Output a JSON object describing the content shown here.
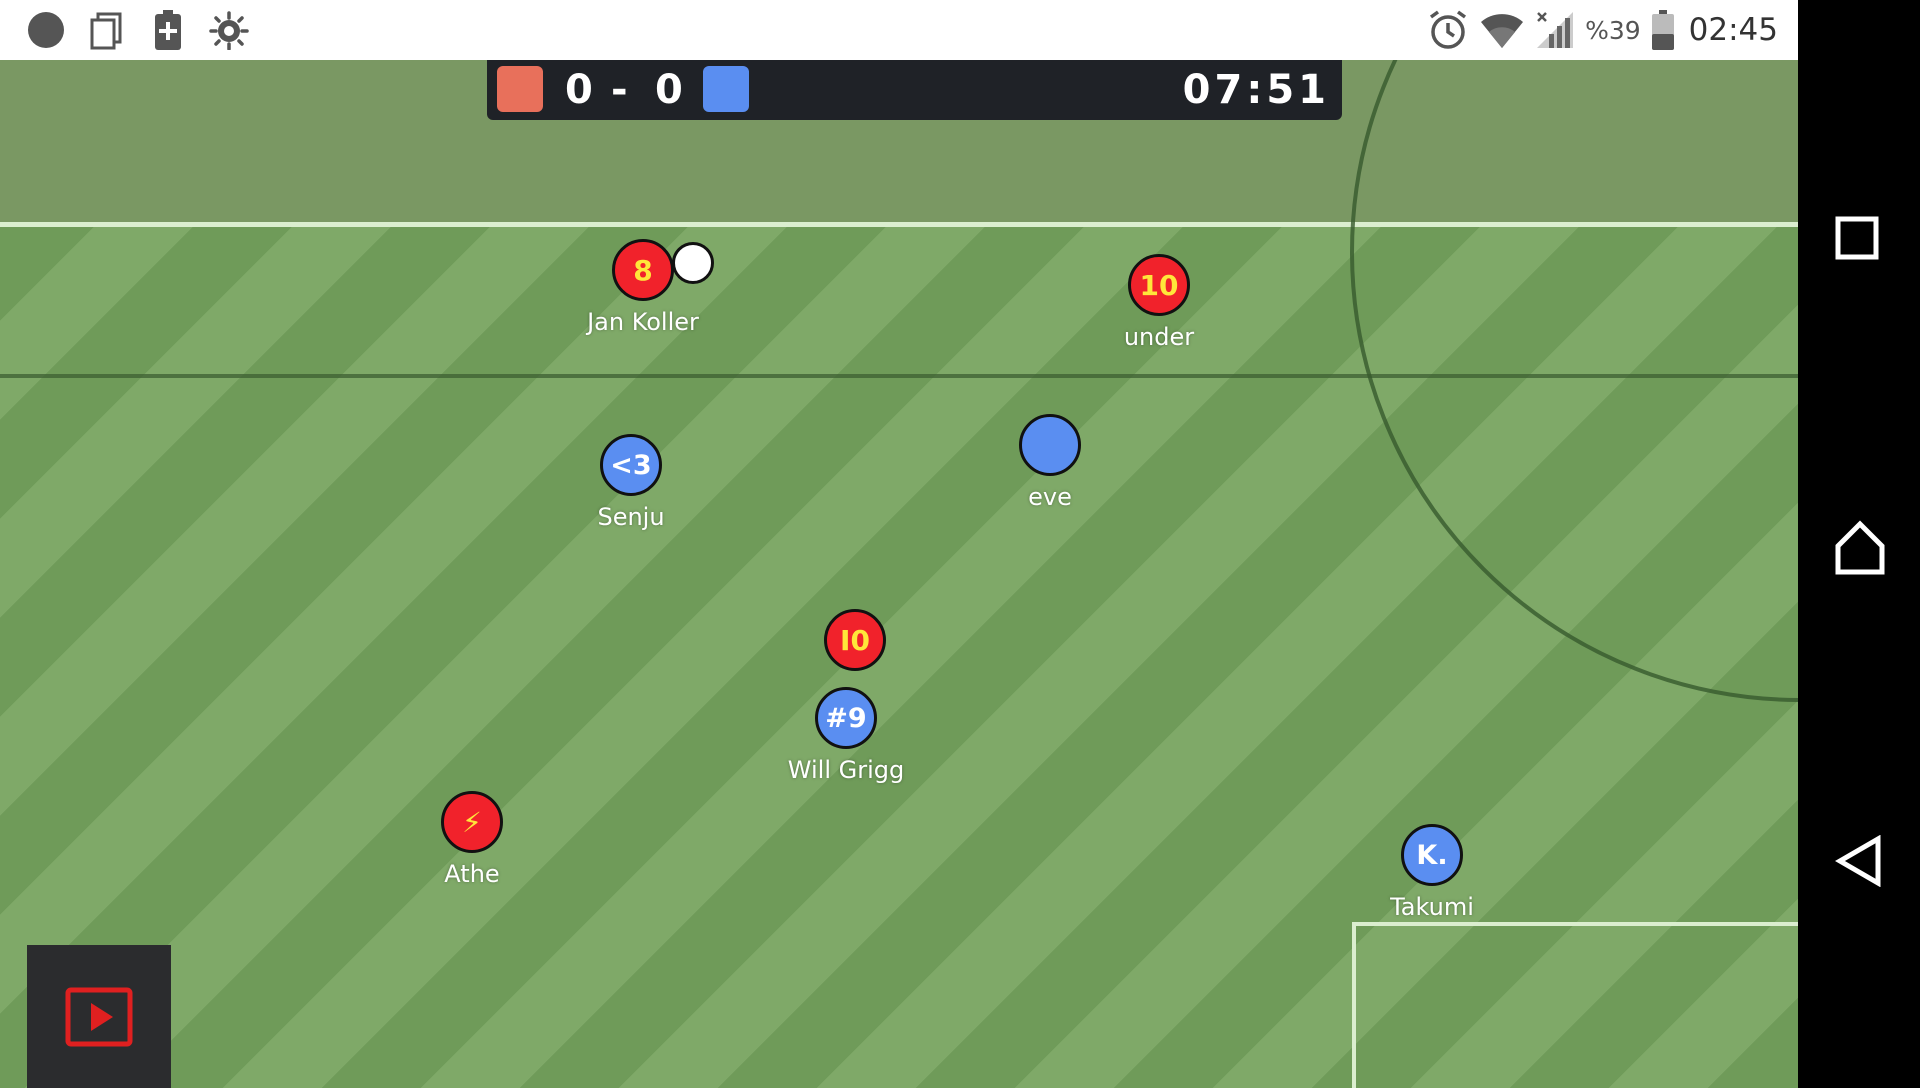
{
  "status_bar": {
    "icons_left": [
      "circle-dot-icon",
      "copy-icon",
      "battery-plus-icon",
      "bug-icon"
    ],
    "icons_right": [
      "alarm-icon",
      "wifi-icon",
      "signal-icon",
      "battery-icon"
    ],
    "battery_percent": "%39",
    "time": "02:45"
  },
  "scoreboard": {
    "home_color": "#e8705b",
    "away_color": "#5a8ef1",
    "home_score": "0",
    "separator": "-",
    "away_score": "0",
    "clock": "07:51"
  },
  "players": [
    {
      "id": "p-jan-koller",
      "team": "red",
      "badge": "8",
      "name": "Jan Koller"
    },
    {
      "id": "p-under",
      "team": "red",
      "badge": "10",
      "name": "under"
    },
    {
      "id": "p-senju",
      "team": "blue",
      "badge": "<3",
      "name": "Senju"
    },
    {
      "id": "p-eve",
      "team": "blue",
      "badge": "",
      "name": "eve"
    },
    {
      "id": "p-red-10b",
      "team": "red",
      "badge": "I0",
      "name": ""
    },
    {
      "id": "p-will-grigg",
      "team": "blue",
      "badge": "#9",
      "name": "Will Grigg"
    },
    {
      "id": "p-athe",
      "team": "red",
      "badge": "⚡",
      "name": "Athe"
    },
    {
      "id": "p-takumi",
      "team": "blue",
      "badge": "K.",
      "name": "Takumi"
    }
  ],
  "replay_button": {
    "icon": "play-video-icon",
    "color": "#e02020"
  },
  "nav_bar": {
    "buttons": [
      "recents-square-icon",
      "home-icon",
      "back-triangle-icon"
    ]
  }
}
